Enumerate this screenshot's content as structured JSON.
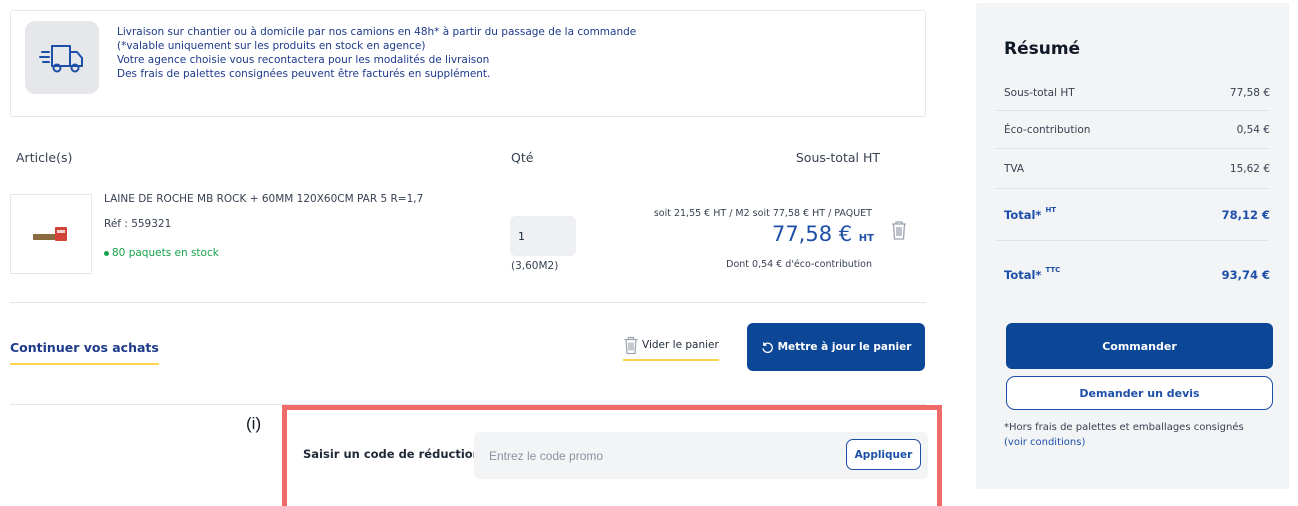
{
  "delivery": {
    "lines": [
      "Livraison sur chantier ou à domicile par nos camions en 48h* à partir du passage de la commande",
      "(*valable uniquement sur les produits en stock en agence)",
      "Votre agence choisie vous recontactera pour les modalités de livraison",
      "Des frais de palettes consignées peuvent être facturés en supplément."
    ],
    "icon": "truck-icon"
  },
  "cart": {
    "headers": {
      "article": "Article(s)",
      "qty": "Qté",
      "subtotal": "Sous-total HT"
    },
    "item": {
      "name": "LAINE DE ROCHE MB ROCK + 60MM 120X60CM PAR 5 R=1,7",
      "ref": "Réf : 559321",
      "stock": "80 paquets en stock",
      "qty": "1",
      "qty_unit": "(3,60M2)",
      "unit_prices": "soit 21,55 € HT / M2 soit 77,58 € HT / PAQUET",
      "price": "77,58 €",
      "price_suffix": "HT",
      "eco": "Dont 0,54 € d'éco-contribution"
    },
    "continue_label": "Continuer vos achats",
    "empty_label": "Vider le panier",
    "update_label": "Mettre à jour le panier"
  },
  "promo": {
    "annotation": "(i)",
    "label": "Saisir un code de réduction",
    "placeholder": "Entrez le code promo",
    "apply_label": "Appliquer"
  },
  "summary": {
    "title": "Résumé",
    "rows": [
      {
        "label": "Sous-total HT",
        "value": "77,58 €"
      },
      {
        "label": "Éco-contribution",
        "value": "0,54 €"
      },
      {
        "label": "TVA",
        "value": "15,62 €"
      }
    ],
    "total_ht": {
      "label": "Total*",
      "sup": "HT",
      "value": "78,12 €"
    },
    "total_ttc": {
      "label": "Total*",
      "sup": "TTC",
      "value": "93,74 €"
    },
    "order_label": "Commander",
    "quote_label": "Demander un devis",
    "note": "*Hors frais de palettes et emballages consignés",
    "note_link": "(voir conditions)"
  },
  "colors": {
    "primary": "#0c4696",
    "accent_blue": "#1e4fa8",
    "stock_green": "#16a34a",
    "underline_yellow": "#fcd34d",
    "annotation_red": "#f06a6a"
  }
}
